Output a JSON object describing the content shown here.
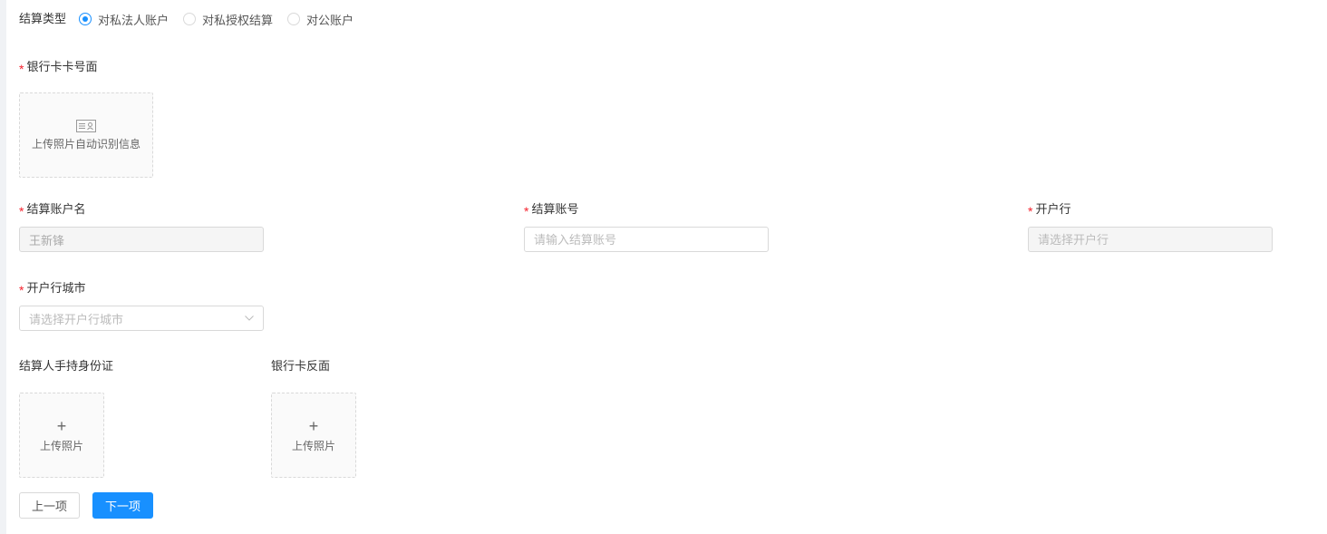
{
  "settlement_type": {
    "label": "结算类型",
    "options": [
      {
        "label": "对私法人账户",
        "checked": true
      },
      {
        "label": "对私授权结算",
        "checked": false
      },
      {
        "label": "对公账户",
        "checked": false
      }
    ]
  },
  "bank_card_front": {
    "required_mark": "*",
    "label": "银行卡卡号面",
    "upload_text": "上传照片自动识别信息",
    "icon": "id-card-icon"
  },
  "account_name": {
    "required_mark": "*",
    "label": "结算账户名",
    "value": "王新锋"
  },
  "account_number": {
    "required_mark": "*",
    "label": "结算账号",
    "placeholder": "请输入结算账号"
  },
  "bank": {
    "required_mark": "*",
    "label": "开户行",
    "placeholder": "请选择开户行"
  },
  "bank_city": {
    "required_mark": "*",
    "label": "开户行城市",
    "placeholder": "请选择开户行城市",
    "icon": "chevron-down-icon"
  },
  "holder_id_photo": {
    "label": "结算人手持身份证",
    "plus": "+",
    "upload_text": "上传照片"
  },
  "bank_card_back": {
    "label": "银行卡反面",
    "plus": "+",
    "upload_text": "上传照片"
  },
  "actions": {
    "prev_label": "上一项",
    "next_label": "下一项"
  },
  "colors": {
    "primary": "#1890ff",
    "required": "#f5222d",
    "border": "#d9d9d9"
  }
}
